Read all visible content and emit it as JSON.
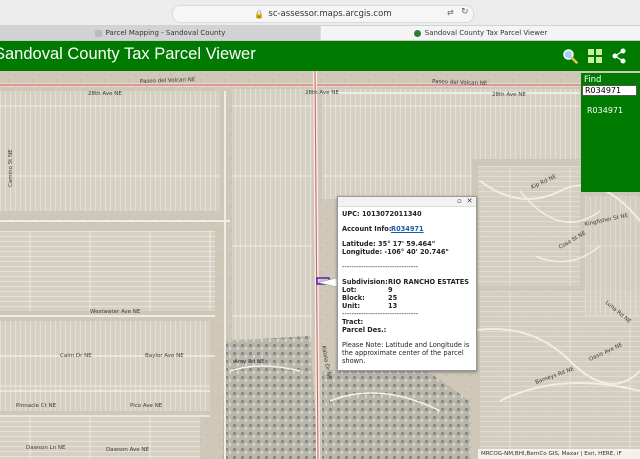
{
  "browser": {
    "url": "sc-assessor.maps.arcgis.com",
    "tabs": [
      {
        "label": "Parcel Mapping - Sandoval County"
      },
      {
        "label": "Sandoval County Tax Parcel Viewer"
      }
    ]
  },
  "header": {
    "title": "Sandoval County Tax Parcel Viewer",
    "accent_color": "#007a00",
    "buttons": [
      "search-icon",
      "grid-icon",
      "share-icon"
    ]
  },
  "find_panel": {
    "label": "Find",
    "input_value": "R034971",
    "result": "R034971"
  },
  "map": {
    "street_labels": [
      "Paseo del Volcan NE",
      "Paseo del Volcan NE",
      "28th Ave NE",
      "28th Ave NE",
      "28th Ave NE",
      "Westwater Ave NE",
      "Calm Dr NE",
      "Baylor Ave NE",
      "Pinnacle Ct NE",
      "Pico Ave NE",
      "Dawson Ln NE",
      "Dawson Ave NE",
      "Kingfisher St NE",
      "Kip Rd NE",
      "Cosa St NE",
      "Luna Rd NE",
      "Oasis Ave NE",
      "Kalala Dr NE",
      "Barneys Rd NE",
      "Camino St NE",
      "Amy Rd NE"
    ]
  },
  "popup": {
    "upc": "UPC: 1013072011340",
    "account_label": "Account Info:",
    "account_link": "R034971",
    "latitude": "Latitude: 35° 17' 59.464\"",
    "longitude": "Longitude: -106° 40' 20.746\"",
    "separator": "--------------------------------",
    "subdivision_label": "Subdivision:",
    "subdivision_value": "RIO RANCHO ESTATES",
    "lot_label": "Lot:",
    "lot_value": "9",
    "block_label": "Block:",
    "block_value": "25",
    "unit_label": "Unit:",
    "unit_value": "13",
    "tract_label": "Tract:",
    "parcel_des_label": "Parcel Des.:",
    "note": "Please Note: Latitude and Longitude is the approximate center of the parcel shown.",
    "note_lines": [
      "Please Note: Latitude and Longitude is",
      "the approximate center of the parcel",
      "shown."
    ]
  },
  "attribution": "MRCOG-NM,BHI,BernCo GIS, Maxar | Esri, HERE, iF"
}
